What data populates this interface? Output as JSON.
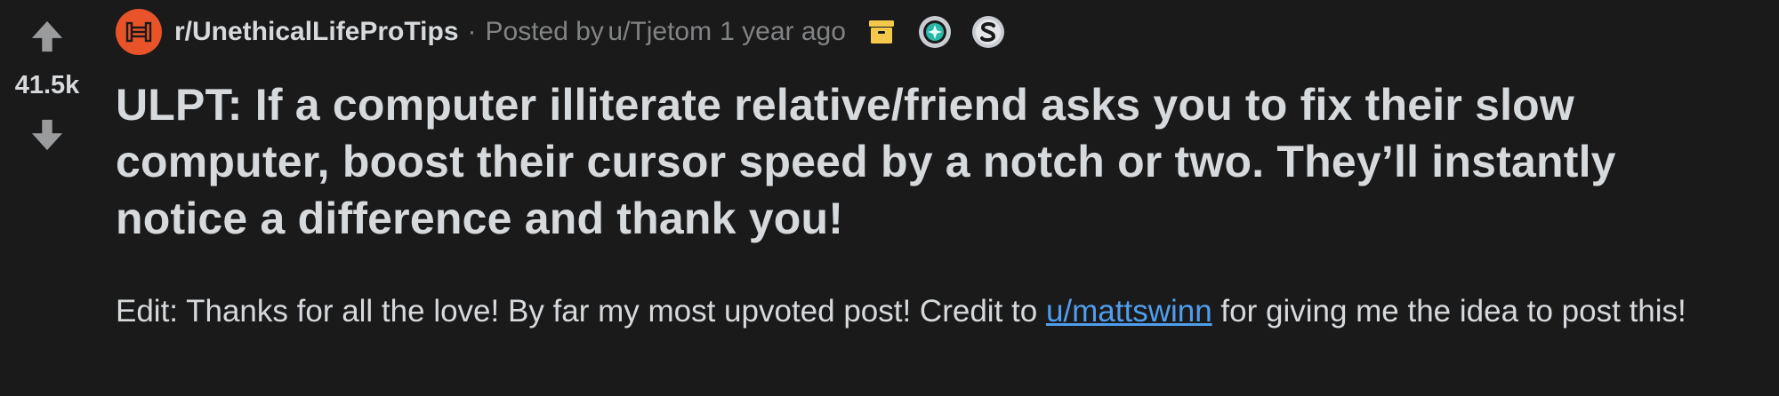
{
  "vote": {
    "score": "41.5k",
    "upvote_icon": "arrow-up-icon",
    "downvote_icon": "arrow-down-icon"
  },
  "meta": {
    "subreddit_icon": "subreddit-icon",
    "subreddit": "r/UnethicalLifeProTips",
    "separator": "·",
    "posted_by_prefix": "Posted by",
    "author": "u/Tjetom",
    "time": "1 year ago",
    "awards": [
      "archive-icon",
      "award-badge-icon",
      "silver-award-icon"
    ]
  },
  "post": {
    "title": "ULPT: If a computer illiterate relative/friend asks you to fix their slow computer, boost their cursor speed by a notch or two. They’ll instantly notice a difference and thank you!",
    "body_before_link": "Edit: Thanks for all the love! By far my most upvoted post! Credit to ",
    "body_link": "u/mattswinn",
    "body_after_link": " for giving me the idea to post this!"
  },
  "colors": {
    "background": "#1a1a1b",
    "text": "#d7dadc",
    "muted": "#818384",
    "link": "#4f9eed",
    "subreddit_icon_bg": "#e8532a",
    "archive_icon": "#f4c84a"
  }
}
